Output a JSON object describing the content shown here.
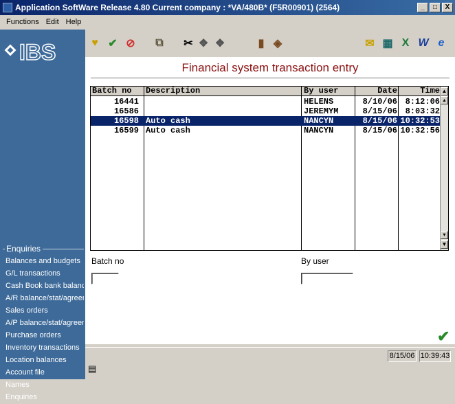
{
  "window": {
    "title": "Application SoftWare Release 4.80 Current company : *VA/480B* (F5R00901) (2564)",
    "minimize": "_",
    "maximize": "□",
    "close": "X"
  },
  "menu": {
    "functions": "Functions",
    "edit": "Edit",
    "help": "Help"
  },
  "logo": {
    "text": "IBS"
  },
  "form": {
    "title": "Financial system transaction entry"
  },
  "grid": {
    "headers": [
      "Batch no",
      "Description",
      "By user",
      "Date",
      "Time"
    ],
    "rows": [
      {
        "batch": "16441",
        "description": "",
        "user": "HELENS",
        "date": "8/10/06",
        "time": "8:12:06"
      },
      {
        "batch": "16586",
        "description": "",
        "user": "JEREMYM",
        "date": "8/15/06",
        "time": "8:03:32"
      },
      {
        "batch": "16598",
        "description": "Auto cash",
        "user": "NANCYN",
        "date": "8/15/06",
        "time": "10:32:53"
      },
      {
        "batch": "16599",
        "description": "Auto cash",
        "user": "NANCYN",
        "date": "8/15/06",
        "time": "10:32:56"
      }
    ],
    "selected_row": 2
  },
  "filters": {
    "batch_label": "Batch no",
    "batch_value": "",
    "user_label": "By user",
    "user_value": ""
  },
  "enquiries": {
    "header": "Enquiries",
    "items": [
      "Balances and budgets",
      "G/L transactions",
      "Cash Book bank balances",
      "A/R balance/stat/agreem/trar",
      "Sales orders",
      "A/P balance/stat/agreem/trar",
      "Purchase orders",
      "Inventory transactions",
      "Location balances",
      "Account file",
      "Names",
      "Enquiries"
    ]
  },
  "status": {
    "date": "8/15/06",
    "time": "10:39:43"
  },
  "colors": {
    "sidebar": "#3d6a99",
    "selection": "#0a246a",
    "title_text": "#8b1010",
    "ok_check": "#2a8a2a"
  },
  "toolbar_icons": [
    "favorite-icon",
    "check-icon",
    "cancel-icon",
    "package-icon",
    "cut-icon",
    "copy-icon",
    "paste-icon",
    "book-icon",
    "documents-icon",
    "mail-icon",
    "calculator-icon",
    "excel-icon",
    "word-icon",
    "internet-explorer-icon"
  ]
}
